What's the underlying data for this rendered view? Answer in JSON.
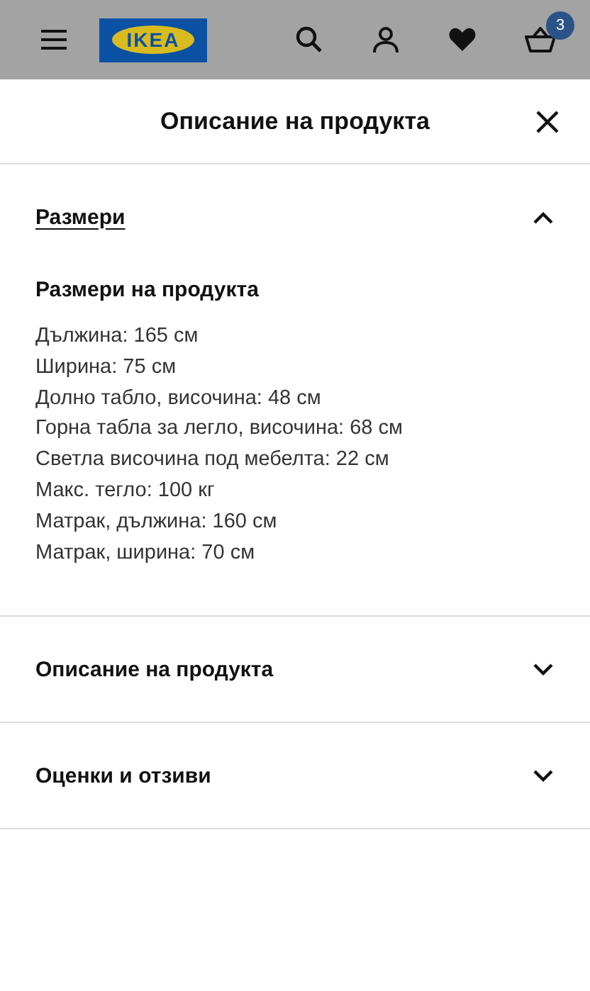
{
  "header": {
    "logo": "IKEA",
    "cart_count": "3"
  },
  "sheet": {
    "title": "Описание на продукта"
  },
  "sections": [
    {
      "title": "Размери",
      "expanded": true,
      "subtitle": "Размери на продукта",
      "lines": [
        "Дължина: 165 см",
        "Ширина: 75 см",
        "Долно табло, височина: 48 см",
        "Горна табла за легло, височина: 68 см",
        "Светла височина под мебелта: 22 см",
        "Макс. тегло: 100 кг",
        "Матрак, дължина: 160 см",
        "Матрак, ширина: 70 см"
      ]
    },
    {
      "title": "Описание на продукта",
      "expanded": false
    },
    {
      "title": "Оценки и отзиви",
      "expanded": false
    }
  ]
}
